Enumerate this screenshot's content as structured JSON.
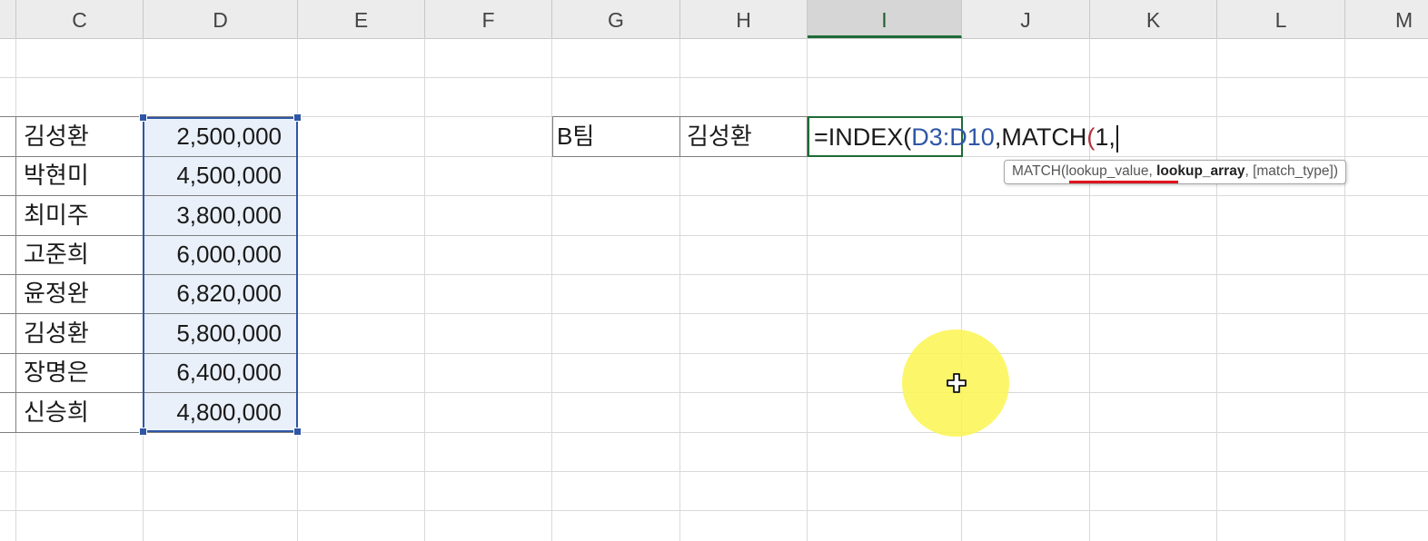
{
  "columns": [
    "C",
    "D",
    "E",
    "F",
    "G",
    "H",
    "I",
    "J",
    "K",
    "L",
    "M"
  ],
  "active_column": "I",
  "table": {
    "names": [
      "김성환",
      "박현미",
      "최미주",
      "고준희",
      "윤정완",
      "김성환",
      "장명은",
      "신승희"
    ],
    "amounts": [
      "2,500,000",
      "4,500,000",
      "3,800,000",
      "6,000,000",
      "6,820,000",
      "5,800,000",
      "6,400,000",
      "4,800,000"
    ]
  },
  "lookup": {
    "team": "B팀",
    "name": "김성환"
  },
  "formula": {
    "prefix": "=INDEX(",
    "ref1": "D3:D10",
    "mid": ",MATCH",
    "paren": "(",
    "tail": "1,"
  },
  "tooltip": {
    "func": "MATCH(",
    "arg1": "lookup_value",
    "sep1": ", ",
    "arg2": "lookup_array",
    "sep2": ", ",
    "arg3": "[match_type])",
    "close": ")"
  },
  "colors": {
    "ref_blue": "#2f56a6",
    "active_green": "#1e6b37",
    "underline_red": "#e0141e",
    "highlight_yellow": "#fcf550"
  },
  "icons": [
    "move-cursor-icon"
  ]
}
